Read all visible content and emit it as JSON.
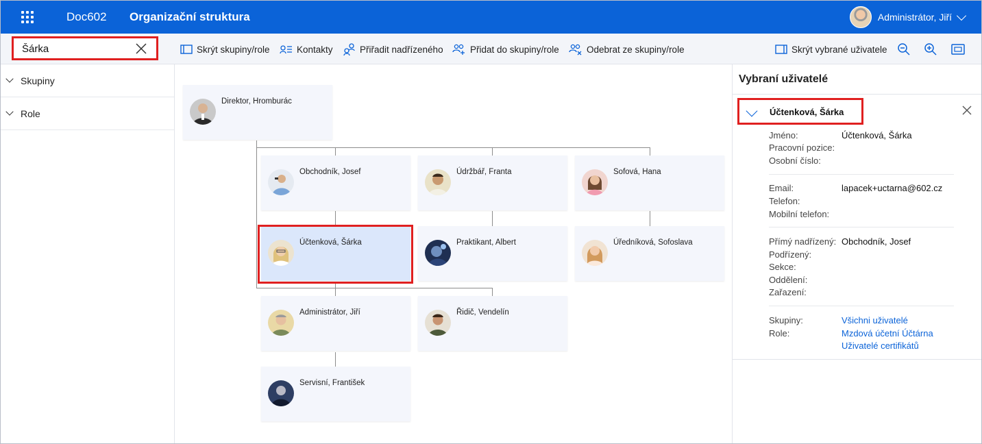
{
  "header": {
    "app_name": "Doc602",
    "page_title": "Organizační struktura",
    "user_name": "Administrátor, Jiří"
  },
  "toolbar": {
    "search_value": "Šárka",
    "hide_groups": "Skrýt skupiny/role",
    "contacts": "Kontakty",
    "assign_superior": "Přiřadit nadřízeného",
    "add_to_group": "Přidat do skupiny/role",
    "remove_from_group": "Odebrat ze skupiny/role",
    "hide_selected": "Skrýt vybrané uživatele"
  },
  "left_panel": {
    "items": [
      {
        "label": "Skupiny"
      },
      {
        "label": "Role"
      }
    ]
  },
  "org_chart": {
    "nodes": [
      {
        "name": "Direktor, Hromburác"
      },
      {
        "name": "Obchodník, Josef"
      },
      {
        "name": "Údržbář, Franta"
      },
      {
        "name": "Sofová, Hana"
      },
      {
        "name": "Účtenková, Šárka"
      },
      {
        "name": "Praktikant, Albert"
      },
      {
        "name": "Úředníková, Sofoslava"
      },
      {
        "name": "Administrátor, Jiří"
      },
      {
        "name": "Řidič, Vendelín"
      },
      {
        "name": "Servisní, František"
      }
    ],
    "selected_node": "Účtenková, Šárka"
  },
  "right_panel": {
    "title": "Vybraní uživatelé",
    "user": {
      "name": "Účtenková, Šárka",
      "fields": {
        "jmeno_label": "Jméno:",
        "jmeno_value": "Účtenková, Šárka",
        "pozice_label": "Pracovní pozice:",
        "cislo_label": "Osobní číslo:",
        "email_label": "Email:",
        "email_value": "lapacek+uctarna@602.cz",
        "telefon_label": "Telefon:",
        "mobil_label": "Mobilní telefon:",
        "nadrizeny_label": "Přímý nadřízený:",
        "nadrizeny_value": "Obchodník, Josef",
        "podrizeni_label": "Podřízený:",
        "sekce_label": "Sekce:",
        "oddeleni_label": "Oddělení:",
        "zarazeni_label": "Zařazení:",
        "skupiny_label": "Skupiny:",
        "skupiny_value": "Všichni uživatelé",
        "role_label": "Role:",
        "role_values": [
          "Mzdová účetní Účtárna",
          "Uživatelé certifikátů"
        ]
      }
    }
  }
}
